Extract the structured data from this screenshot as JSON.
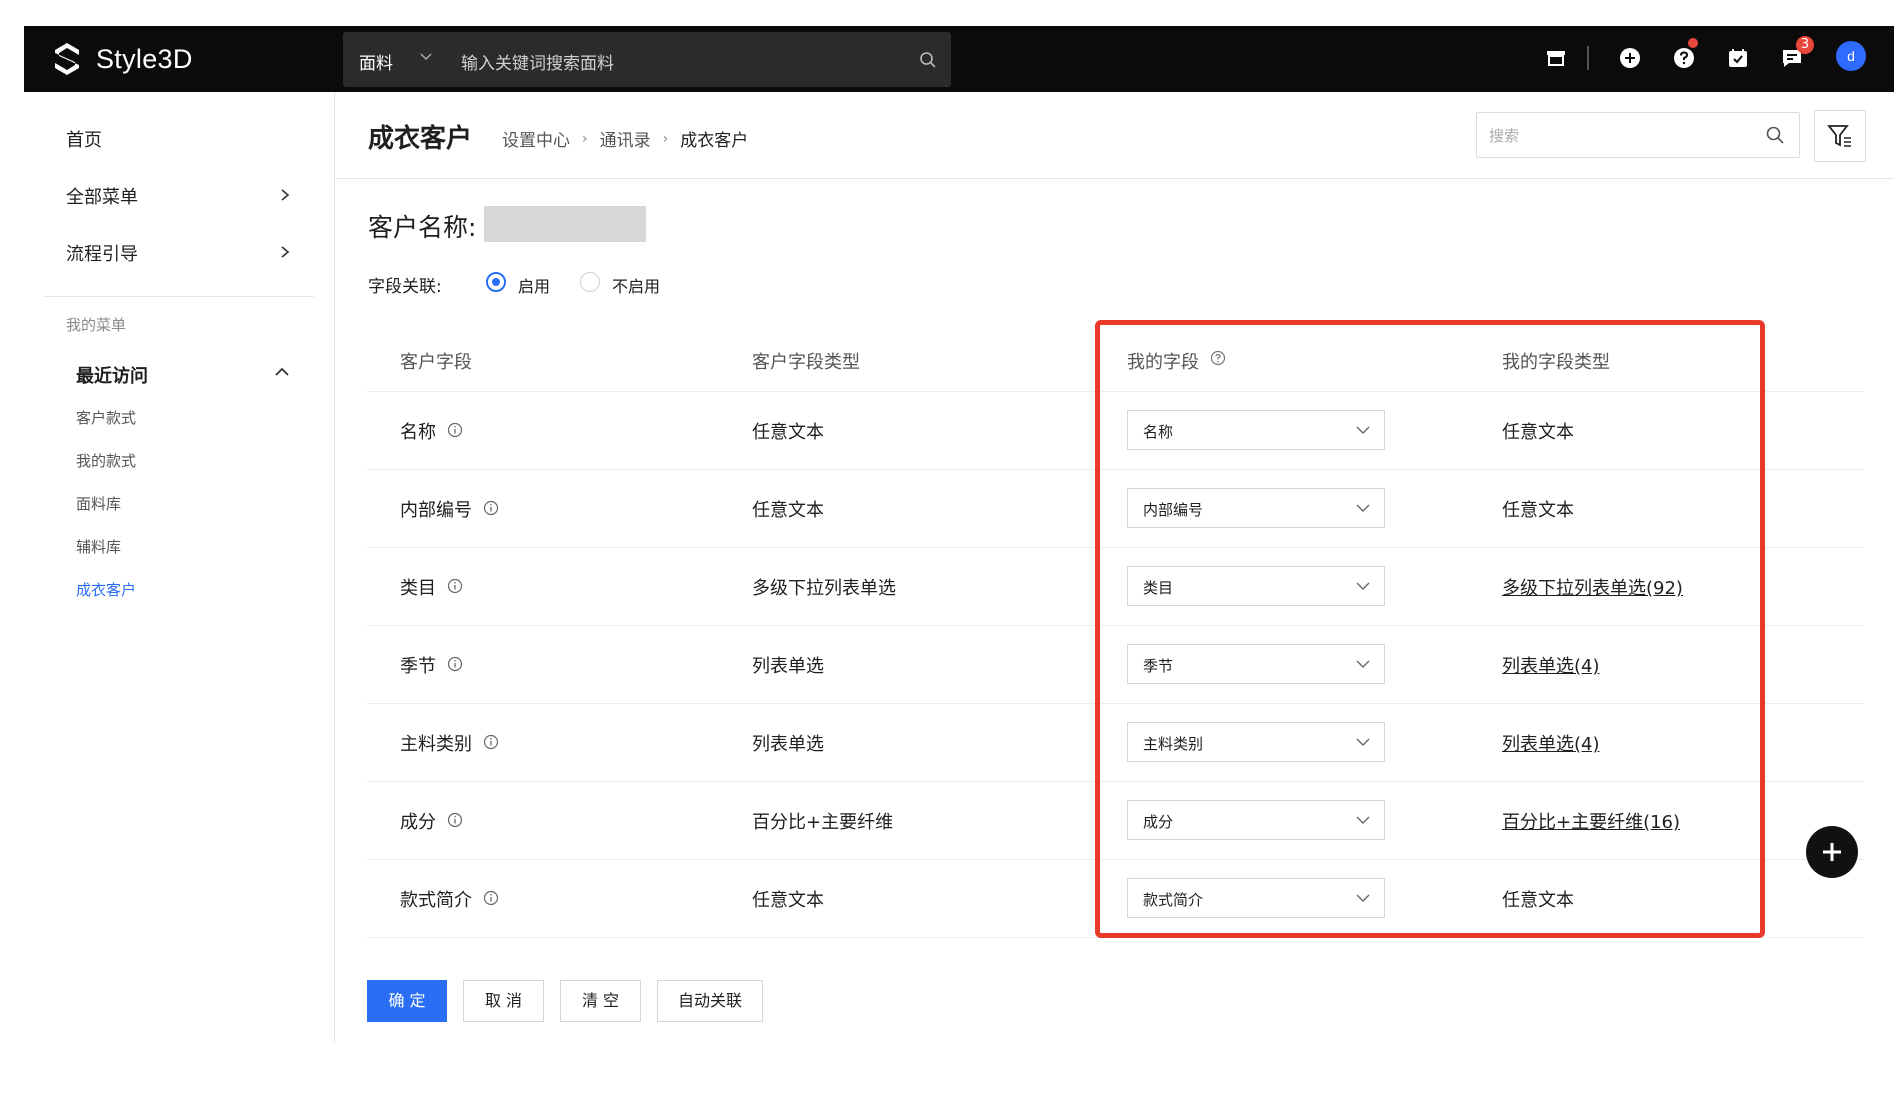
{
  "topbar": {
    "brand": "Style3D",
    "search_category": "面料",
    "search_placeholder": "输入关键词搜索面料",
    "notification_count": "3",
    "avatar_initial": "d"
  },
  "sidebar": {
    "nav": [
      {
        "label": "首页"
      },
      {
        "label": "全部菜单"
      },
      {
        "label": "流程引导"
      }
    ],
    "section_title": "我的菜单",
    "recent_title": "最近访问",
    "recent_items": [
      {
        "label": "客户款式"
      },
      {
        "label": "我的款式"
      },
      {
        "label": "面料库"
      },
      {
        "label": "辅料库"
      },
      {
        "label": "成衣客户"
      }
    ]
  },
  "header": {
    "title": "成衣客户",
    "breadcrumb": [
      "设置中心",
      "通讯录",
      "成衣客户"
    ],
    "search_placeholder": "搜索"
  },
  "form": {
    "customer_name_label": "客户名称:",
    "relation_label": "字段关联:",
    "relation_options": [
      "启用",
      "不启用"
    ],
    "relation_selected": "启用"
  },
  "table": {
    "headers": [
      "客户字段",
      "客户字段类型",
      "我的字段",
      "我的字段类型"
    ],
    "rows": [
      {
        "field": "名称",
        "field_type": "任意文本",
        "my_field": "名称",
        "my_type": "任意文本",
        "my_type_link": false
      },
      {
        "field": "内部编号",
        "field_type": "任意文本",
        "my_field": "内部编号",
        "my_type": "任意文本",
        "my_type_link": false
      },
      {
        "field": "类目",
        "field_type": "多级下拉列表单选",
        "my_field": "类目",
        "my_type": "多级下拉列表单选(92)",
        "my_type_link": true
      },
      {
        "field": "季节",
        "field_type": "列表单选",
        "my_field": "季节",
        "my_type": "列表单选(4)",
        "my_type_link": true
      },
      {
        "field": "主料类别",
        "field_type": "列表单选",
        "my_field": "主料类别",
        "my_type": "列表单选(4)",
        "my_type_link": true
      },
      {
        "field": "成分",
        "field_type": "百分比+主要纤维",
        "my_field": "成分",
        "my_type": "百分比+主要纤维(16)",
        "my_type_link": true
      },
      {
        "field": "款式简介",
        "field_type": "任意文本",
        "my_field": "款式简介",
        "my_type": "任意文本",
        "my_type_link": false
      }
    ]
  },
  "actions": {
    "confirm": "确 定",
    "cancel": "取 消",
    "clear": "清 空",
    "auto": "自动关联"
  },
  "colors": {
    "accent": "#2a6ef5",
    "highlight_border": "#e8392a",
    "topbar_bg": "#0b0b0b"
  }
}
